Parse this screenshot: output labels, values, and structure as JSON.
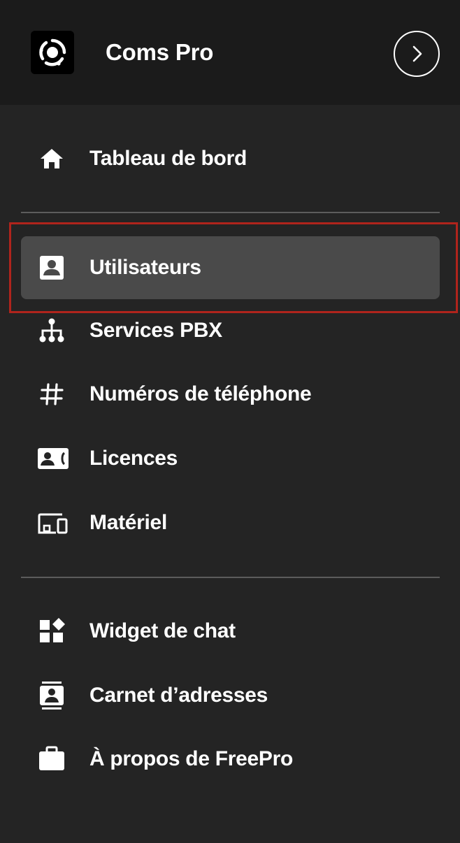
{
  "app": {
    "title": "Coms Pro",
    "logo_icon": "ring-logo-icon",
    "expand_icon": "chevron-right-icon"
  },
  "nav": {
    "primary": [
      {
        "id": "dashboard",
        "label": "Tableau de bord",
        "icon": "home-icon",
        "active": false
      }
    ],
    "management": [
      {
        "id": "users",
        "label": "Utilisateurs",
        "icon": "user-badge-icon",
        "active": true
      },
      {
        "id": "pbx",
        "label": "Services PBX",
        "icon": "hierarchy-icon",
        "active": false
      },
      {
        "id": "numbers",
        "label": "Numéros de téléphone",
        "icon": "hashtag-icon",
        "active": false
      },
      {
        "id": "licenses",
        "label": "Licences",
        "icon": "contact-card-icon",
        "active": false
      },
      {
        "id": "hardware",
        "label": "Matériel",
        "icon": "devices-icon",
        "active": false
      }
    ],
    "tools": [
      {
        "id": "chat-widget",
        "label": "Widget de chat",
        "icon": "widgets-icon",
        "active": false
      },
      {
        "id": "address-book",
        "label": "Carnet d’adresses",
        "icon": "address-book-icon",
        "active": false
      },
      {
        "id": "about",
        "label": "À propos de FreePro",
        "icon": "briefcase-icon",
        "active": false
      }
    ]
  },
  "colors": {
    "background": "#242424",
    "header": "#1b1b1b",
    "active_item": "#4a4a4a",
    "divider": "#5c5c5c",
    "highlight": "#b0241c",
    "text": "#ffffff"
  }
}
